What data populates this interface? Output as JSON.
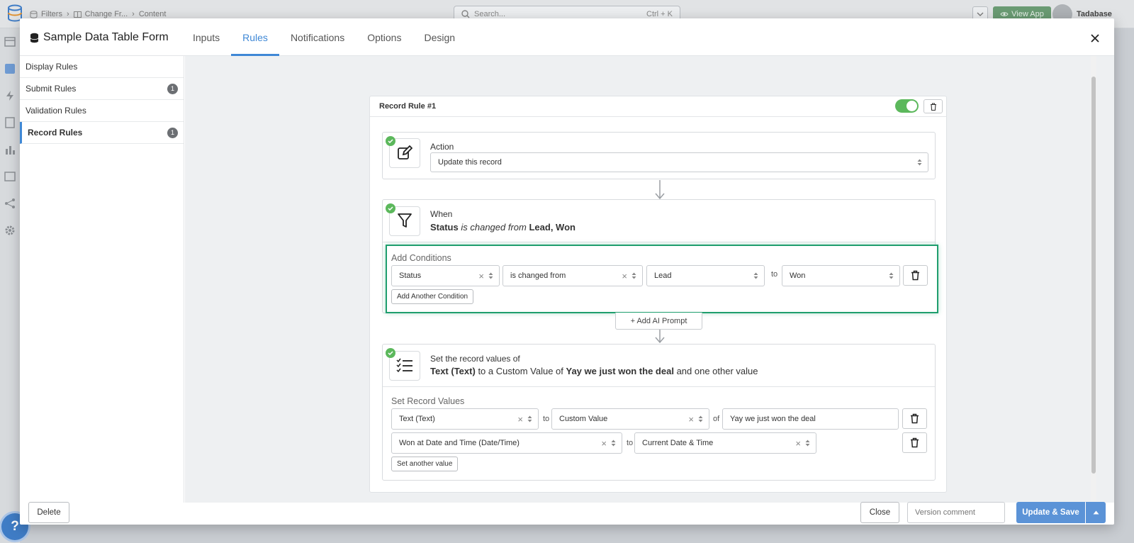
{
  "background": {
    "breadcrumbs": [
      "Filters",
      "Change Fr...",
      "Content"
    ],
    "search": {
      "placeholder": "Search...",
      "shortcut": "Ctrl + K"
    },
    "view_app_label": "View App",
    "user_name": "Tadabase",
    "help_label": "?"
  },
  "modal": {
    "title": "Sample Data Table Form",
    "tabs": [
      {
        "label": "Inputs",
        "active": false
      },
      {
        "label": "Rules",
        "active": true
      },
      {
        "label": "Notifications",
        "active": false
      },
      {
        "label": "Options",
        "active": false
      },
      {
        "label": "Design",
        "active": false
      }
    ],
    "sidebar": [
      {
        "label": "Display Rules",
        "count": null,
        "active": false
      },
      {
        "label": "Submit Rules",
        "count": "1",
        "active": false
      },
      {
        "label": "Validation Rules",
        "count": null,
        "active": false
      },
      {
        "label": "Record Rules",
        "count": "1",
        "active": true
      }
    ]
  },
  "rule": {
    "title": "Record Rule #1",
    "enabled": true,
    "action": {
      "label": "Action",
      "value": "Update this record"
    },
    "when": {
      "label": "When",
      "summary_field": "Status",
      "summary_operator": "is changed from",
      "summary_values": "Lead, Won",
      "section_label": "Add Conditions",
      "condition": {
        "field": "Status",
        "operator": "is changed from",
        "from_value": "Lead",
        "to_label": "to",
        "to_value": "Won"
      },
      "add_condition_label": "Add Another Condition"
    },
    "ai_prompt_label": "+ Add AI Prompt",
    "set_values": {
      "label": "Set the record values of",
      "summary_field": "Text (Text)",
      "summary_mid": "to a Custom Value of",
      "summary_value": "Yay we just won the deal",
      "summary_tail": "and one other value",
      "section_label": "Set Record Values",
      "rows": [
        {
          "field": "Text (Text)",
          "to_label": "to",
          "type": "Custom Value",
          "of_label": "of",
          "value": "Yay we just won the deal"
        },
        {
          "field": "Won at Date and Time (Date/Time)",
          "to_label": "to",
          "type": "Current Date & Time"
        }
      ],
      "add_value_label": "Set another value"
    }
  },
  "footer": {
    "delete_label": "Delete",
    "close_label": "Close",
    "version_placeholder": "Version comment",
    "update_save_label": "Update & Save"
  },
  "colors": {
    "accent": "#3f88d6",
    "success": "#5cb85c",
    "highlight_border": "#1f9e6e",
    "primary_button": "#5b93d7"
  }
}
